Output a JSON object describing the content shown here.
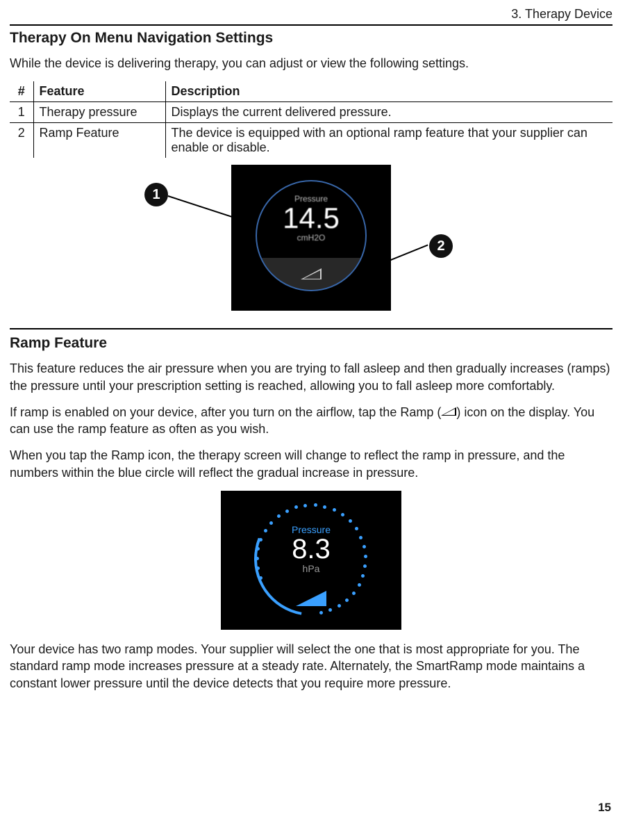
{
  "chapter": "3. Therapy Device",
  "section1_title": "Therapy On Menu Navigation Settings",
  "section1_intro": "While the device is delivering therapy, you can adjust or view the following settings.",
  "table": {
    "headers": {
      "num": "#",
      "feature": "Feature",
      "desc": "Description"
    },
    "rows": [
      {
        "num": "1",
        "feature": "Therapy pressure",
        "desc": "Displays the current delivered pressure."
      },
      {
        "num": "2",
        "feature": "Ramp Feature",
        "desc": "The device is equipped with an optional ramp feature that your supplier can enable or disable."
      }
    ]
  },
  "callouts": {
    "one": "1",
    "two": "2"
  },
  "screen1": {
    "label": "Pressure",
    "value": "14.5",
    "unit": "cmH2O"
  },
  "section2_title": "Ramp Feature",
  "ramp_p1": "This feature reduces the air pressure when you are trying to fall asleep and then gradually increases (ramps) the pressure until your prescription setting is reached, allowing you to fall asleep more comfortably.",
  "ramp_p2a": "If ramp is enabled on your device, after you turn on the airflow, tap the Ramp (",
  "ramp_p2b": ") icon on the display. You can use the ramp feature as often as you wish.",
  "ramp_p3": "When you tap the Ramp icon, the therapy screen will change to reflect the ramp in pressure, and the numbers within the blue circle will reflect the gradual increase in pressure.",
  "screen2": {
    "label": "Pressure",
    "value": "8.3",
    "unit": "hPa"
  },
  "ramp_p4": "Your device has two ramp modes. Your supplier will select the one that is most appropriate for you. The standard ramp mode increases pressure at a steady rate.  Alternately, the SmartRamp mode maintains a constant lower pressure until the device detects that you require more pressure.",
  "page_number": "15"
}
